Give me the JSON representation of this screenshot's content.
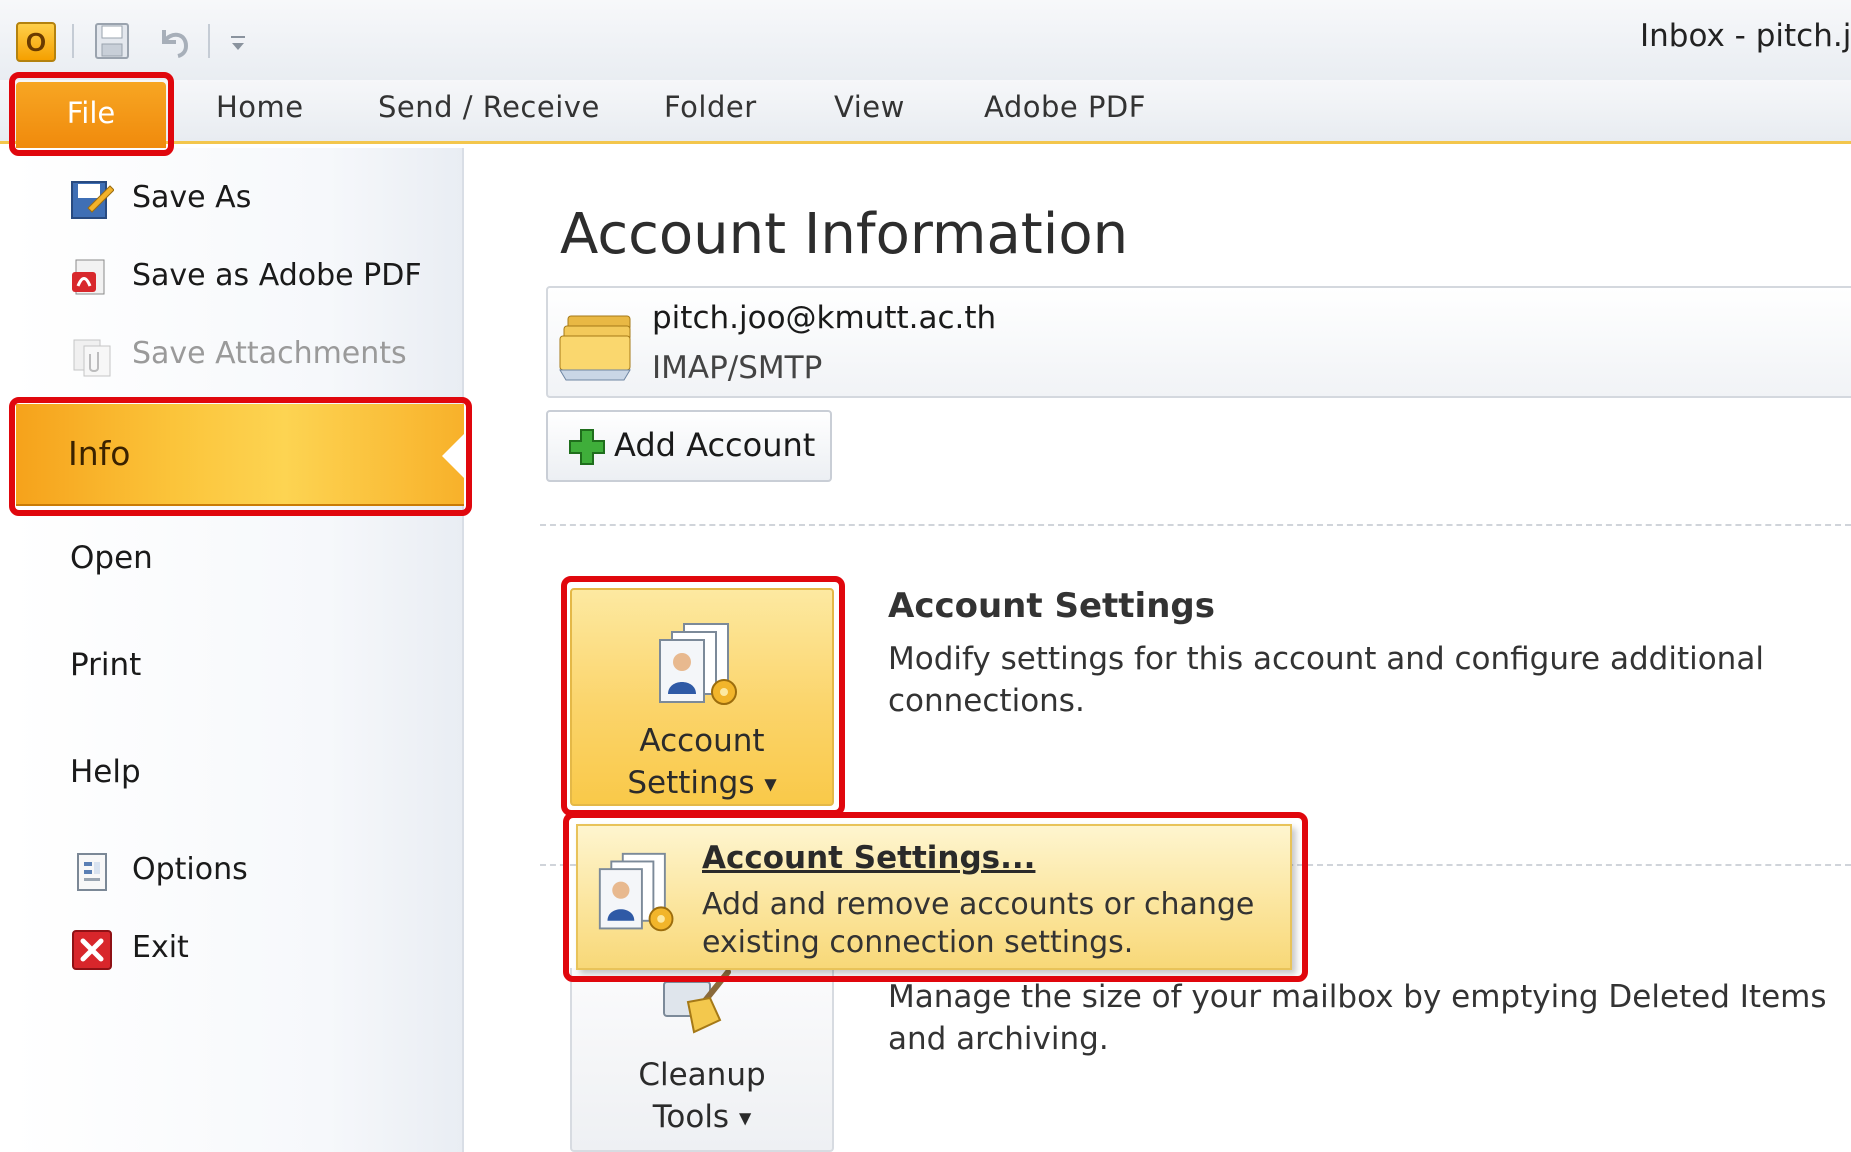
{
  "window": {
    "title": "Inbox - pitch.j"
  },
  "quick_access": {
    "app_icon": "outlook-icon",
    "app_letter": "O",
    "buttons": [
      "save-icon",
      "undo-icon",
      "customize-qat-icon"
    ]
  },
  "ribbon": {
    "file_tab": "File",
    "tabs": [
      "Home",
      "Send / Receive",
      "Folder",
      "View",
      "Adobe PDF"
    ]
  },
  "backstage": {
    "items": {
      "save_as": "Save As",
      "save_as_pdf": "Save as Adobe PDF",
      "save_attachments": "Save Attachments",
      "info": "Info",
      "open": "Open",
      "print": "Print",
      "help": "Help",
      "options": "Options",
      "exit": "Exit"
    }
  },
  "main": {
    "title": "Account Information",
    "account": {
      "email": "pitch.joo@kmutt.ac.th",
      "type": "IMAP/SMTP"
    },
    "add_account": "Add Account",
    "account_settings_button": {
      "line1": "Account",
      "line2": "Settings"
    },
    "account_settings_section": {
      "title": "Account Settings",
      "description": "Modify settings for this account and configure additional connections."
    },
    "dropdown_item": {
      "title": "Account Settings...",
      "description": "Add and remove accounts or change existing connection settings."
    },
    "cleanup_button": {
      "line1": "Cleanup",
      "line2": "Tools"
    },
    "cleanup_section": {
      "description": "Manage the size of your mailbox by emptying Deleted Items and archiving."
    }
  },
  "colors": {
    "file_tab": "#f08a0c",
    "info_highlight": "#fbc43a",
    "annotation_red": "#e0070d",
    "ribbon_accent": "#f3c64c"
  }
}
